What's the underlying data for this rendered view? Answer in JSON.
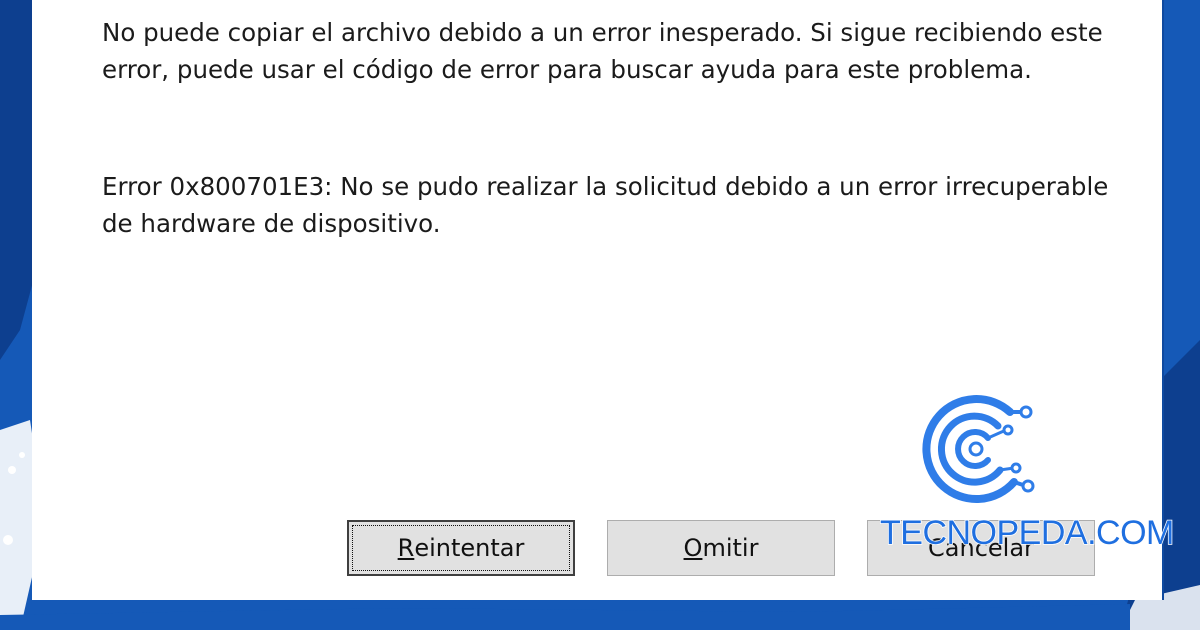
{
  "dialog": {
    "message_primary": "No puede copiar el archivo debido a un error inesperado. Si sigue recibiendo este error, puede usar el código de error para buscar ayuda para este problema.",
    "message_error": "Error 0x800701E3: No se pudo realizar la solicitud debido a un error irrecuperable de hardware de dispositivo.",
    "buttons": {
      "retry": {
        "mnemonic": "R",
        "rest": "eintentar"
      },
      "skip": {
        "mnemonic": "O",
        "rest": "mitir"
      },
      "cancel": {
        "label": "Cancelar"
      }
    }
  },
  "watermark": {
    "text": "TECNOPEDA.COM",
    "logo_icon": "circuit-c-logo-icon"
  },
  "colors": {
    "background": "#1559b7",
    "dialog": "#ffffff",
    "button": "#e1e1e1",
    "brand": "#1f6fe0"
  }
}
